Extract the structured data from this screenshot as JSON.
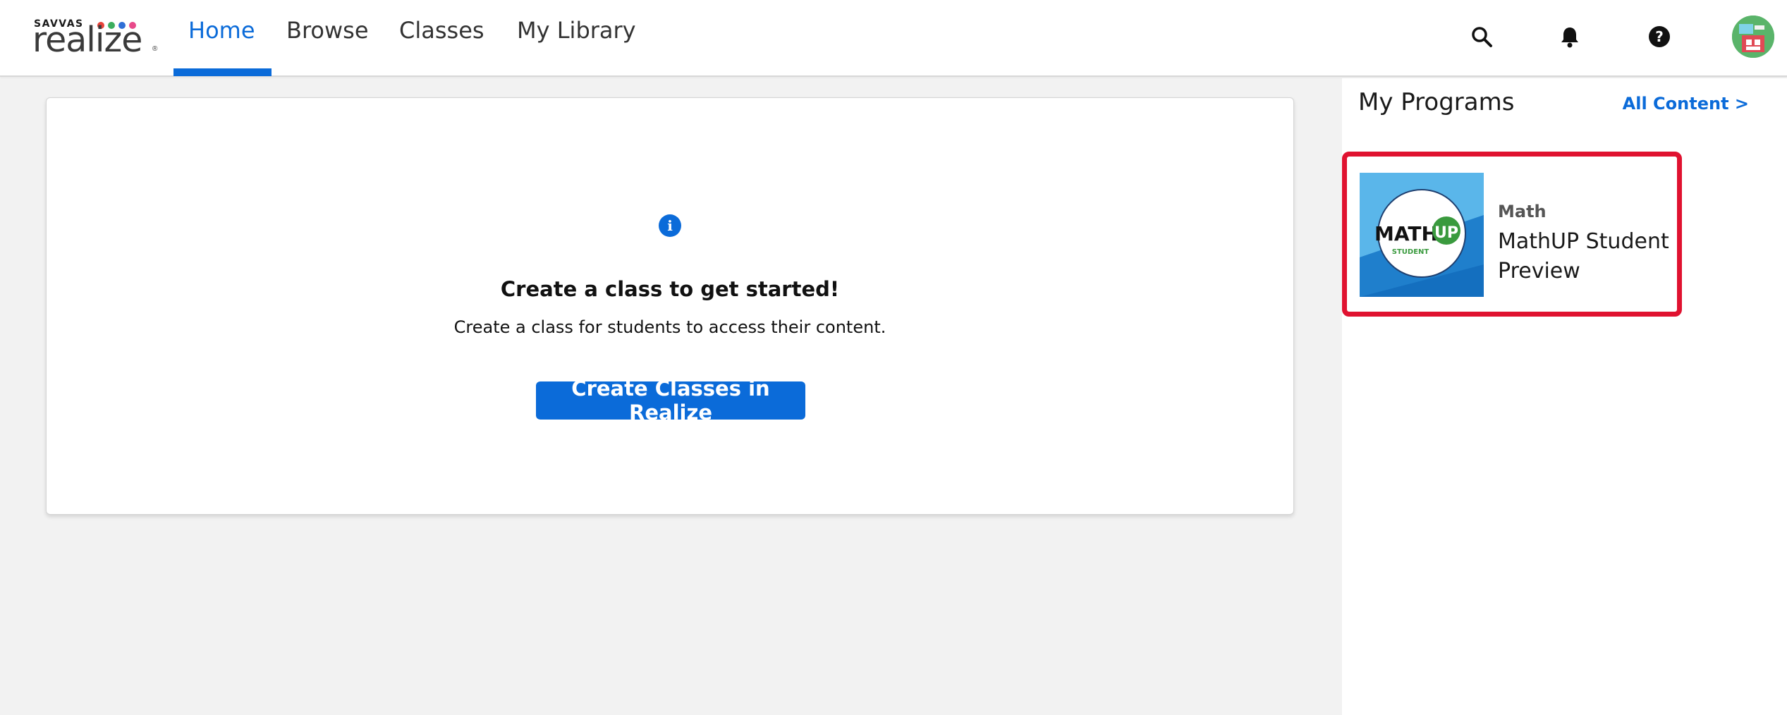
{
  "brand": {
    "small": "SAVVAS",
    "name": "realize",
    "reg": "®",
    "dot_colors": [
      "#e8443a",
      "#3cae5e",
      "#2f6fd6",
      "#e84a8a"
    ]
  },
  "nav": {
    "items": [
      {
        "label": "Home",
        "active": true
      },
      {
        "label": "Browse",
        "active": false
      },
      {
        "label": "Classes",
        "active": false
      },
      {
        "label": "My Library",
        "active": false
      }
    ]
  },
  "header_icons": [
    "search-icon",
    "bell-icon",
    "help-icon",
    "avatar"
  ],
  "main": {
    "info_icon": "info-icon",
    "title": "Create a class to get started!",
    "subtitle": "Create a class for students to access their content.",
    "button_label": "Create Classes in Realize"
  },
  "right_panel": {
    "title": "My Programs",
    "all_content_label": "All Content >",
    "programs": [
      {
        "subject": "Math",
        "name": "MathUP Student Preview",
        "logo_text_main": "MATH",
        "logo_text_up": "UP",
        "logo_text_sub": "STUDENT"
      }
    ]
  },
  "colors": {
    "accent": "#0b6bd9",
    "highlight": "#e01230",
    "background": "#f2f2f2"
  }
}
